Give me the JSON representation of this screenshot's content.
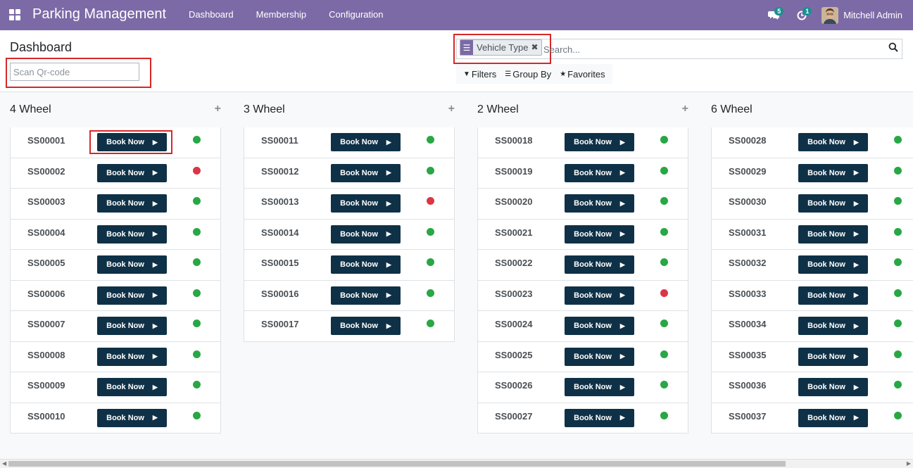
{
  "navbar": {
    "app_title": "Parking Management",
    "menu": [
      "Dashboard",
      "Membership",
      "Configuration"
    ],
    "messages_badge": "5",
    "activities_badge": "1",
    "user_name": "Mitchell Admin"
  },
  "control_panel": {
    "breadcrumb": "Dashboard",
    "qr_placeholder": "Scan Qr-code",
    "facet_label": "Vehicle Type",
    "search_placeholder": "Search...",
    "filters_label": "Filters",
    "groupby_label": "Group By",
    "favorites_label": "Favorites"
  },
  "colors": {
    "brand": "#7c6aa6",
    "button": "#0f3147",
    "available": "#28a745",
    "occupied": "#dc3545"
  },
  "book_label": "Book Now",
  "columns": [
    {
      "title": "4 Wheel",
      "slots": [
        {
          "name": "SS00001",
          "status": "available"
        },
        {
          "name": "SS00002",
          "status": "occupied"
        },
        {
          "name": "SS00003",
          "status": "available"
        },
        {
          "name": "SS00004",
          "status": "available"
        },
        {
          "name": "SS00005",
          "status": "available"
        },
        {
          "name": "SS00006",
          "status": "available"
        },
        {
          "name": "SS00007",
          "status": "available"
        },
        {
          "name": "SS00008",
          "status": "available"
        },
        {
          "name": "SS00009",
          "status": "available"
        },
        {
          "name": "SS00010",
          "status": "available"
        }
      ]
    },
    {
      "title": "3 Wheel",
      "slots": [
        {
          "name": "SS00011",
          "status": "available"
        },
        {
          "name": "SS00012",
          "status": "available"
        },
        {
          "name": "SS00013",
          "status": "occupied"
        },
        {
          "name": "SS00014",
          "status": "available"
        },
        {
          "name": "SS00015",
          "status": "available"
        },
        {
          "name": "SS00016",
          "status": "available"
        },
        {
          "name": "SS00017",
          "status": "available"
        }
      ]
    },
    {
      "title": "2 Wheel",
      "slots": [
        {
          "name": "SS00018",
          "status": "available"
        },
        {
          "name": "SS00019",
          "status": "available"
        },
        {
          "name": "SS00020",
          "status": "available"
        },
        {
          "name": "SS00021",
          "status": "available"
        },
        {
          "name": "SS00022",
          "status": "available"
        },
        {
          "name": "SS00023",
          "status": "occupied"
        },
        {
          "name": "SS00024",
          "status": "available"
        },
        {
          "name": "SS00025",
          "status": "available"
        },
        {
          "name": "SS00026",
          "status": "available"
        },
        {
          "name": "SS00027",
          "status": "available"
        }
      ]
    },
    {
      "title": "6 Wheel",
      "slots": [
        {
          "name": "SS00028",
          "status": "available"
        },
        {
          "name": "SS00029",
          "status": "available"
        },
        {
          "name": "SS00030",
          "status": "available"
        },
        {
          "name": "SS00031",
          "status": "available"
        },
        {
          "name": "SS00032",
          "status": "available"
        },
        {
          "name": "SS00033",
          "status": "available"
        },
        {
          "name": "SS00034",
          "status": "available"
        },
        {
          "name": "SS00035",
          "status": "available"
        },
        {
          "name": "SS00036",
          "status": "available"
        },
        {
          "name": "SS00037",
          "status": "available"
        }
      ]
    }
  ]
}
